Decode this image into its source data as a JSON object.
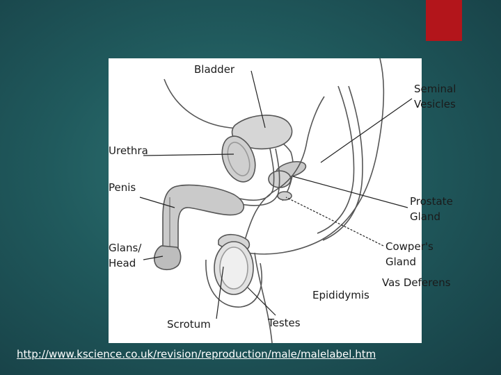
{
  "labels": {
    "bladder": "Bladder",
    "seminal_vesicles": "Seminal\nVesicles",
    "urethra": "Urethra",
    "penis": "Penis",
    "prostate_gland": "Prostate\nGland",
    "glans_head": "Glans/\nHead",
    "cowpers_gland": "Cowper's\nGland",
    "vas_deferens": "Vas Deferens",
    "epididymis": "Epididymis",
    "scrotum": "Scrotum",
    "testes": "Testes"
  },
  "credit": "http://www.kscience.co.uk/revision/reproduction/male/malelabel.htm",
  "colors": {
    "accent_red": "#b3151b",
    "background": "#205a5d"
  }
}
